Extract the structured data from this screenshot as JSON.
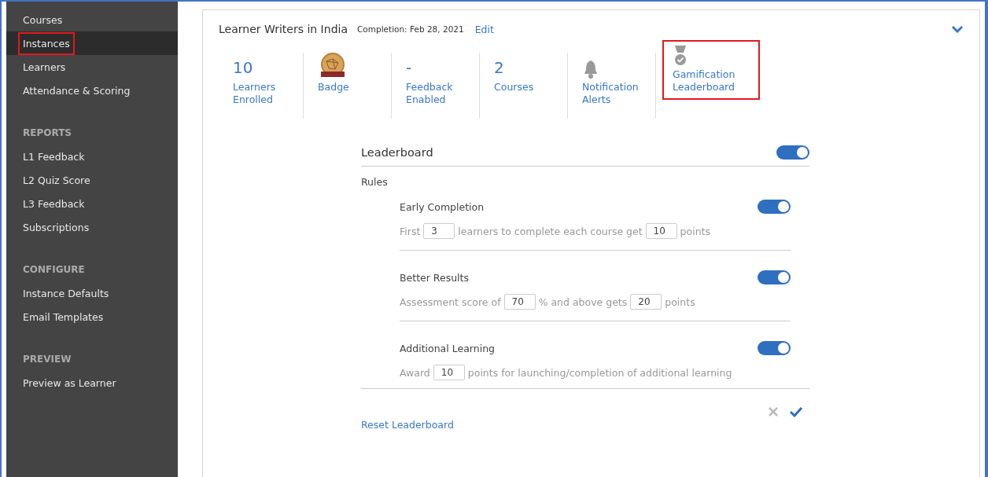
{
  "sidebar": {
    "groups": [
      {
        "items": [
          {
            "label": "Courses",
            "selected": false,
            "highlighted": false
          },
          {
            "label": "Instances",
            "selected": true,
            "highlighted": true
          },
          {
            "label": "Learners",
            "selected": false,
            "highlighted": false
          },
          {
            "label": "Attendance & Scoring",
            "selected": false,
            "highlighted": false
          }
        ]
      },
      {
        "heading": "REPORTS",
        "items": [
          {
            "label": "L1 Feedback",
            "selected": false,
            "highlighted": false
          },
          {
            "label": "L2 Quiz Score",
            "selected": false,
            "highlighted": false
          },
          {
            "label": "L3 Feedback",
            "selected": false,
            "highlighted": false
          },
          {
            "label": "Subscriptions",
            "selected": false,
            "highlighted": false
          }
        ]
      },
      {
        "heading": "CONFIGURE",
        "items": [
          {
            "label": "Instance Defaults",
            "selected": false,
            "highlighted": false
          },
          {
            "label": "Email Templates",
            "selected": false,
            "highlighted": false
          }
        ]
      },
      {
        "heading": "PREVIEW",
        "items": [
          {
            "label": "Preview as Learner",
            "selected": false,
            "highlighted": false
          }
        ]
      }
    ]
  },
  "instance": {
    "title": "Learner Writers in India",
    "completion": "Completion: Feb 28, 2021",
    "edit": "Edit",
    "expanded": true
  },
  "stats": [
    {
      "kind": "number",
      "value": "10",
      "label": "Learners Enrolled",
      "highlighted": false
    },
    {
      "kind": "badge",
      "label": "Badge",
      "highlighted": false
    },
    {
      "kind": "number",
      "value": "-",
      "label": "Feedback Enabled",
      "highlighted": false
    },
    {
      "kind": "number",
      "value": "2",
      "label": "Courses",
      "highlighted": false
    },
    {
      "kind": "bell",
      "label": "Notification Alerts",
      "highlighted": false
    },
    {
      "kind": "medal",
      "label": "Gamification Leaderboard",
      "highlighted": true
    }
  ],
  "leaderboard": {
    "title": "Leaderboard",
    "on": true,
    "rules_label": "Rules",
    "rules": [
      {
        "title": "Early Completion",
        "on": true,
        "parts": [
          {
            "kind": "text",
            "text": "First"
          },
          {
            "kind": "input",
            "value": "3"
          },
          {
            "kind": "text",
            "text": "learners to complete each course get"
          },
          {
            "kind": "input",
            "value": "10"
          },
          {
            "kind": "text",
            "text": "points"
          }
        ]
      },
      {
        "title": "Better Results",
        "on": true,
        "parts": [
          {
            "kind": "text",
            "text": "Assessment score of"
          },
          {
            "kind": "input",
            "value": "70"
          },
          {
            "kind": "text",
            "text": "% and above gets"
          },
          {
            "kind": "input",
            "value": "20"
          },
          {
            "kind": "text",
            "text": "points"
          }
        ]
      },
      {
        "title": "Additional Learning",
        "on": true,
        "parts": [
          {
            "kind": "text",
            "text": "Award"
          },
          {
            "kind": "input",
            "value": "10"
          },
          {
            "kind": "text",
            "text": "points for launching/completion of additional learning"
          }
        ]
      }
    ],
    "reset": "Reset Leaderboard"
  }
}
